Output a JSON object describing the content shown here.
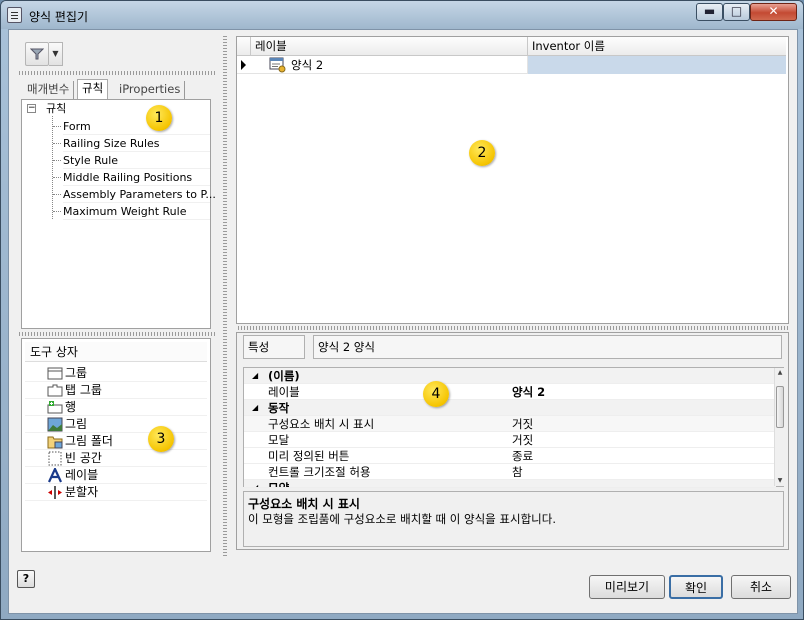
{
  "window": {
    "title": "양식 편집기",
    "minimize": "▬",
    "maximize": "□",
    "close": "✕"
  },
  "left_panel": {
    "tabs": [
      "매개변수",
      "규칙",
      "iProperties"
    ],
    "active_tab": "규칙",
    "tree_root": "규칙",
    "tree_items": [
      "Form",
      "Railing Size Rules",
      "Style Rule",
      "Middle Railing Positions",
      "Assembly Parameters to P...",
      "Maximum Weight Rule"
    ],
    "badge": "1"
  },
  "grid": {
    "columns": [
      "레이블",
      "Inventor 이름"
    ],
    "row_label": "양식 2",
    "row_name": "",
    "badge": "2"
  },
  "toolbox": {
    "header": "도구 상자",
    "items": [
      {
        "icon": "group-icon",
        "label": "그룹"
      },
      {
        "icon": "tab-group-icon",
        "label": "탭 그룹"
      },
      {
        "icon": "row-icon",
        "label": "행"
      },
      {
        "icon": "picture-icon",
        "label": "그림"
      },
      {
        "icon": "picture-folder-icon",
        "label": "그림 폴더"
      },
      {
        "icon": "empty-space-icon",
        "label": "빈 공간"
      },
      {
        "icon": "label-icon",
        "label": "레이블"
      },
      {
        "icon": "splitter-icon",
        "label": "분할자"
      }
    ],
    "badge": "3"
  },
  "properties": {
    "caption": "특성",
    "object": "양식 2 양식",
    "rows": [
      {
        "type": "category",
        "name": "(이름)"
      },
      {
        "type": "prop",
        "name": "레이블",
        "value": "양식 2",
        "bold": true
      },
      {
        "type": "category",
        "name": "동작"
      },
      {
        "type": "prop",
        "name": "구성요소 배치 시 표시",
        "value": "거짓"
      },
      {
        "type": "prop",
        "name": "모달",
        "value": "거짓"
      },
      {
        "type": "prop",
        "name": "미리 정의된 버튼",
        "value": "종료"
      },
      {
        "type": "prop",
        "name": "컨트롤 크기조절 허용",
        "value": "참"
      },
      {
        "type": "category",
        "name": "모양"
      }
    ],
    "desc_title": "구성요소 배치 시 표시",
    "desc_text": "이 모형을 조립품에 구성요소로 배치할 때 이 양식을 표시합니다.",
    "badge": "4"
  },
  "footer": {
    "help": "?",
    "preview": "미리보기",
    "ok": "확인",
    "cancel": "취소"
  },
  "colors": {
    "selected_cell": "#c9d9ea",
    "badge": "#f5c400"
  }
}
